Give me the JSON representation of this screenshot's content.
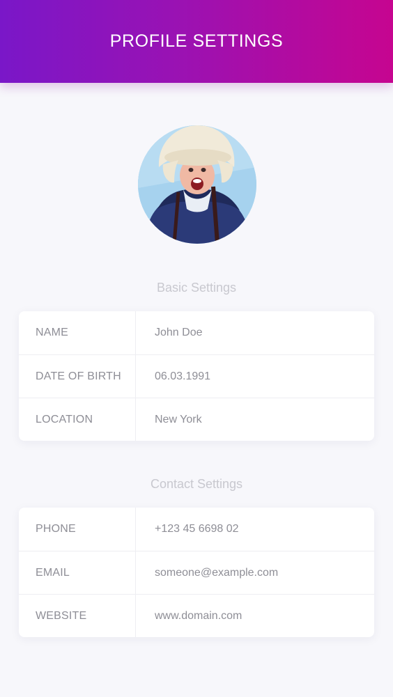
{
  "header": {
    "title": "PROFILE SETTINGS"
  },
  "avatar": {
    "icon": "avatar-photo"
  },
  "basic": {
    "title": "Basic Settings",
    "rows": [
      {
        "label": "NAME",
        "value": "John Doe"
      },
      {
        "label": "DATE OF BIRTH",
        "value": "06.03.1991"
      },
      {
        "label": "LOCATION",
        "value": "New York"
      }
    ]
  },
  "contact": {
    "title": "Contact Settings",
    "rows": [
      {
        "label": "PHONE",
        "value": "+123 45 6698 02"
      },
      {
        "label": "EMAIL",
        "value": "someone@example.com"
      },
      {
        "label": "WEBSITE",
        "value": "www.domain.com"
      }
    ]
  },
  "colors": {
    "gradient_start": "#7a17c8",
    "gradient_end": "#c60590",
    "background": "#f7f7fb",
    "text_muted": "#8e8e96"
  }
}
